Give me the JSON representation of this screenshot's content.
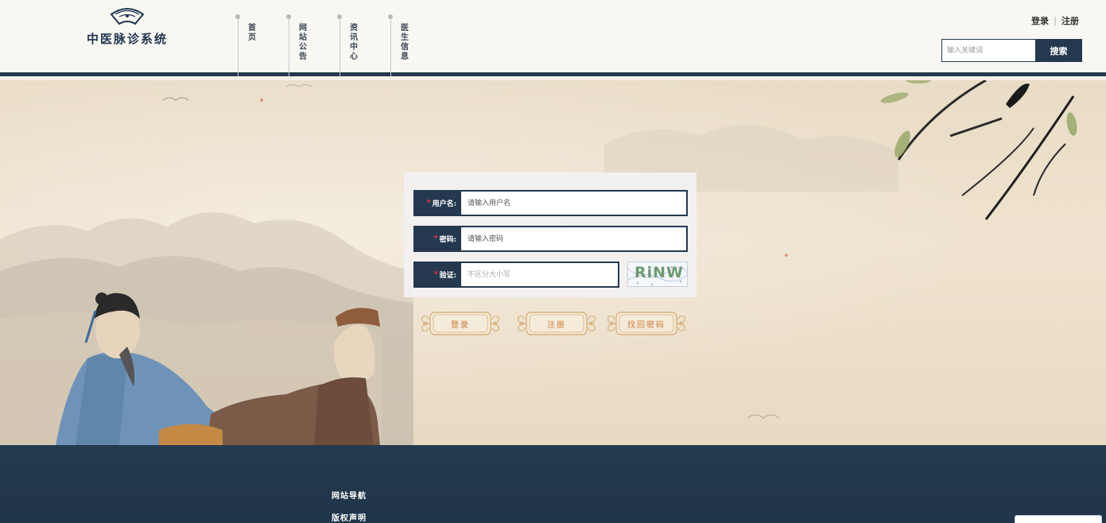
{
  "site": {
    "title": "中医脉诊系统"
  },
  "nav": {
    "items": [
      {
        "label": "首页"
      },
      {
        "label": "网站公告"
      },
      {
        "label": "资讯中心"
      },
      {
        "label": "医生信息"
      }
    ]
  },
  "auth": {
    "login": "登录",
    "register": "注册"
  },
  "search": {
    "placeholder": "输入关键词",
    "button": "搜索"
  },
  "form": {
    "username_label": "用户名:",
    "username_placeholder": "请输入用户名",
    "password_label": "密码:",
    "password_placeholder": "请输入密码",
    "captcha_label": "验证:",
    "captcha_placeholder": "不区分大小写",
    "captcha_text": "RiNW",
    "required_mark": "*"
  },
  "buttons": {
    "login": "登录",
    "register": "注册",
    "recover": "找回密码"
  },
  "footer": {
    "links": [
      {
        "label": "网站导航"
      },
      {
        "label": "版权声明"
      }
    ]
  },
  "colors": {
    "primary": "#24394f",
    "accent_text": "#d9a273",
    "required": "#e53b3b"
  }
}
